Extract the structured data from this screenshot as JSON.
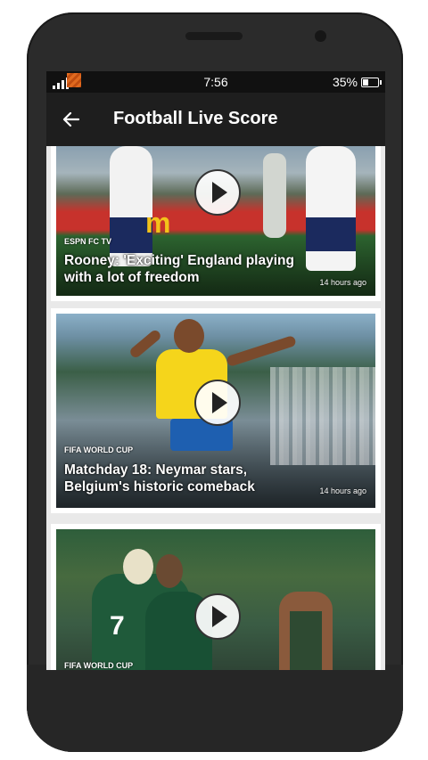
{
  "status_bar": {
    "time": "7:56",
    "battery": "35%",
    "battery_level": 0.35
  },
  "app_bar": {
    "title": "Football Live Score",
    "back_icon": "arrow-left-icon"
  },
  "feed": {
    "items": [
      {
        "source": "ESPN FC TV",
        "headline": "Rooney: 'Exciting' England playing with a lot of freedom",
        "time_ago": "14 hours ago"
      },
      {
        "source": "FIFA WORLD CUP",
        "headline": "Matchday 18: Neymar stars, Belgium's historic comeback",
        "time_ago": "14 hours ago"
      },
      {
        "source": "FIFA WORLD CUP",
        "headline": "",
        "time_ago": ""
      }
    ]
  },
  "colors": {
    "app_bar": "#1e1e1e",
    "status_bar": "#111111",
    "feed_bg": "#e9e9e9"
  }
}
